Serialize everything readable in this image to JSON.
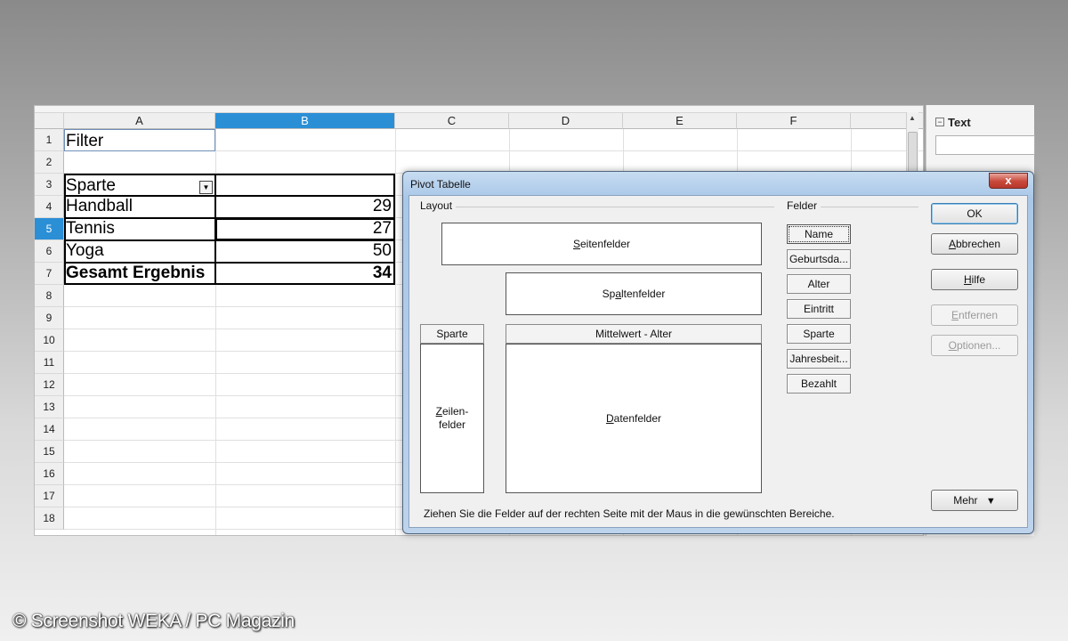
{
  "spreadsheet": {
    "columns": [
      {
        "label": "A",
        "selected": false
      },
      {
        "label": "B",
        "selected": true
      },
      {
        "label": "C",
        "selected": false
      },
      {
        "label": "D",
        "selected": false
      },
      {
        "label": "E",
        "selected": false
      },
      {
        "label": "F",
        "selected": false
      }
    ],
    "rows": [
      "1",
      "2",
      "3",
      "4",
      "5",
      "6",
      "7",
      "8",
      "9",
      "10",
      "11",
      "12",
      "13",
      "14",
      "15",
      "16",
      "17",
      "18"
    ],
    "selected_row": "5",
    "cells": {
      "a1": "Filter",
      "a3": "Sparte",
      "a4": "Handball",
      "b4": "29",
      "a5": "Tennis",
      "b5": "27",
      "a6": "Yoga",
      "b6": "50",
      "a7": "Gesamt Ergebnis",
      "b7": "34"
    },
    "filter_dropdown_icon": "chevron-down-icon"
  },
  "side_panel": {
    "title": "Text",
    "collapse_icon": "minus-box-icon"
  },
  "dialog": {
    "title": "Pivot Tabelle",
    "close_label": "x",
    "layout_label": "Layout",
    "fields_label": "Felder",
    "zones": {
      "page": {
        "pre": "",
        "mn": "S",
        "post": "eitenfelder"
      },
      "column": {
        "pre": "Sp",
        "mn": "a",
        "post": "ltenfelder"
      },
      "row": {
        "line1_mn": "Z",
        "line1_post": "eilen-",
        "line2": "felder"
      },
      "data": {
        "pre": "",
        "mn": "D",
        "post": "atenfelder"
      }
    },
    "row_field_chip": "Sparte",
    "data_field_chip": "Mittelwert - Alter",
    "fields": [
      "Name",
      "Geburtsda...",
      "Alter",
      "Eintritt",
      "Sparte",
      "Jahresbeit...",
      "Bezahlt"
    ],
    "buttons": {
      "ok": "OK",
      "cancel": {
        "pre": "",
        "mn": "A",
        "post": "bbrechen"
      },
      "help": {
        "pre": "",
        "mn": "H",
        "post": "ilfe"
      },
      "remove": {
        "pre": "",
        "mn": "E",
        "post": "ntfernen"
      },
      "options": {
        "pre": "",
        "mn": "O",
        "post": "ptionen..."
      },
      "more": "Mehr",
      "more_icon": "double-chevron-down-icon"
    },
    "hint": "Ziehen Sie die Felder auf der rechten Seite mit der Maus in die gewünschten Bereiche."
  },
  "watermark": "© Screenshot WEKA / PC Magazin"
}
